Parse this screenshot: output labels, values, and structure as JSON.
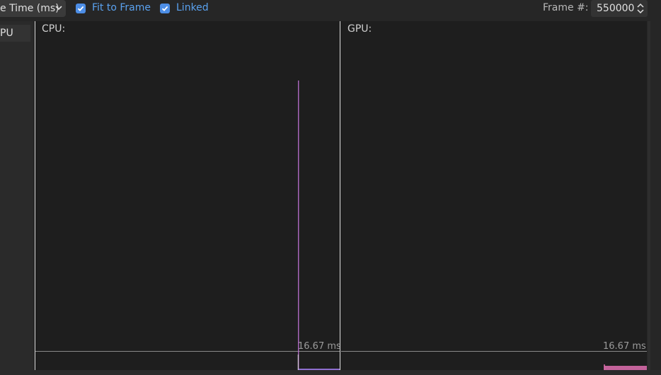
{
  "toolbar": {
    "metric_value": "e Time (ms)",
    "fit_to_frame": {
      "label": "Fit to Frame",
      "checked": true
    },
    "linked": {
      "label": "Linked",
      "checked": true
    },
    "frame_label": "Frame #:",
    "frame_value": "550000"
  },
  "left_panel": {
    "tab_label": "PU"
  },
  "graphs": {
    "cpu": {
      "title": "CPU:",
      "budget_label": "16.67 ms"
    },
    "gpu": {
      "title": "GPU:",
      "budget_label": "16.67 ms"
    }
  },
  "colors": {
    "accent": "#4d8ee6",
    "cpu_spike": "#c777e0",
    "gpu_bars": "#e06fb0",
    "panel_bg": "#1e1e1e"
  }
}
